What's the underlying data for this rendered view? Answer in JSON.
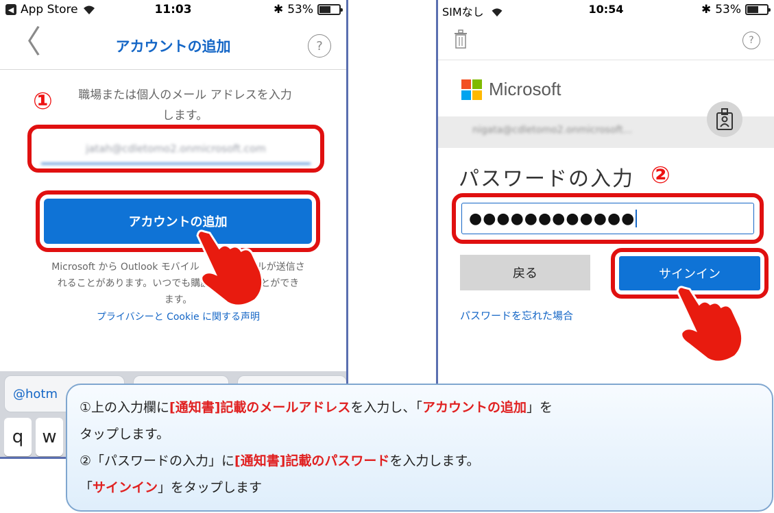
{
  "left_phone": {
    "status_bar": {
      "back_app": "App Store",
      "time": "11:03",
      "battery": "53%"
    },
    "nav": {
      "back_glyph": "〈",
      "title": "アカウントの追加",
      "help": "?"
    },
    "step_marker": "①",
    "instruction_line1": "職場または個人のメール アドレスを入力",
    "instruction_line2": "します。",
    "email_value": "jatah@cdletomo2.onmicrosoft.com",
    "add_account_button": "アカウントの追加",
    "notice_line1": "Microsoft から Outlook モバイル",
    "notice_line1_end": "ールが送信さ",
    "notice_line2": "れることがあります。いつでも購読",
    "notice_line2_end": "ことができ",
    "notice_line3": "ます。",
    "privacy_link": "プライバシーと Cookie に関する声明",
    "suggestions": [
      "@hotm",
      "",
      ""
    ],
    "keys": [
      "q",
      "w"
    ]
  },
  "right_phone": {
    "status_bar": {
      "carrier": "SIMなし",
      "time": "10:54",
      "battery": "53%"
    },
    "help": "?",
    "brand": "Microsoft",
    "account_email": "nigata@cdletomo2.onmicrosoft...",
    "password_title": "パスワードの入力",
    "step_marker": "②",
    "password_mask": "●●●●●●●●●●●●",
    "back_button": "戻る",
    "signin_button": "サインイン",
    "forgot_link": "パスワードを忘れた場合"
  },
  "callout": {
    "l1_a": "①上の入力欄に",
    "l1_b": "[通知書]記載のメールアドレス",
    "l1_c": "を入力し、「",
    "l1_d": "アカウントの追加",
    "l1_e": "」を",
    "l2": "タップします。",
    "l3_a": "②「パスワードの入力」に",
    "l3_b": "[通知書]記載のパスワード",
    "l3_c": "を入力します。",
    "l4_a": "「",
    "l4_b": "サインイン",
    "l4_c": "」をタップします"
  },
  "colors": {
    "accent_blue": "#0f73d6",
    "highlight_red": "#e01010",
    "ms_red": "#f25022",
    "ms_green": "#7fba00",
    "ms_blue": "#00a4ef",
    "ms_yellow": "#ffb900"
  }
}
